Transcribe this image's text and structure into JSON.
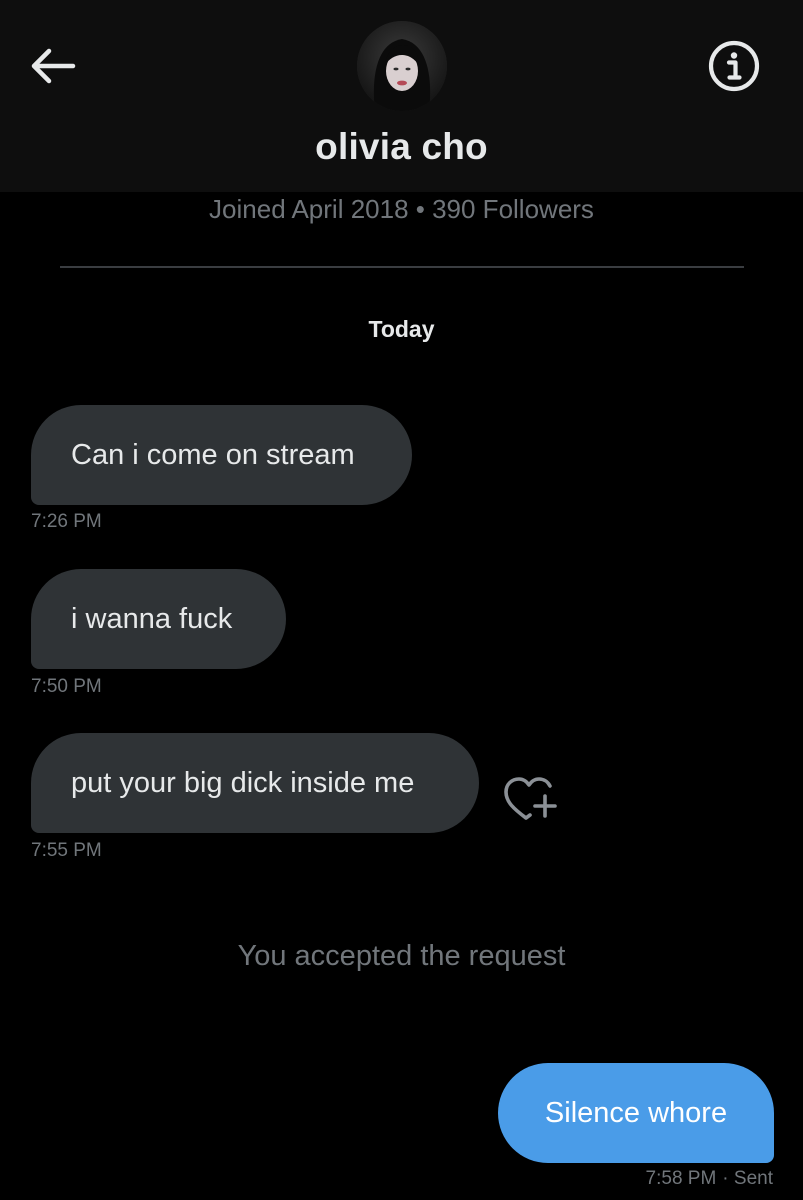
{
  "header": {
    "back_icon": "arrow-left-icon",
    "info_icon": "info-circle-icon",
    "name": "olivia cho"
  },
  "profile": {
    "meta": "Joined April 2018 • 390 Followers"
  },
  "conversation": {
    "date_label": "Today",
    "messages": [
      {
        "direction": "received",
        "text": "Can i come on stream",
        "time": "7:26 PM"
      },
      {
        "direction": "received",
        "text": "i wanna fuck",
        "time": "7:50 PM"
      },
      {
        "direction": "received",
        "text": "put your big dick inside me",
        "time": "7:55 PM",
        "reaction_icon": "heart-plus-icon"
      },
      {
        "direction": "sent",
        "text": "Silence whore",
        "time": "7:58 PM",
        "status": "· Sent"
      }
    ],
    "system_note": "You accepted the request"
  },
  "colors": {
    "background": "#000000",
    "header_bg": "#0e0e0e",
    "received_bubble": "#2f3336",
    "sent_bubble": "#4a9ce8",
    "muted_text": "#71767b",
    "primary_text": "#e7e9ea"
  }
}
